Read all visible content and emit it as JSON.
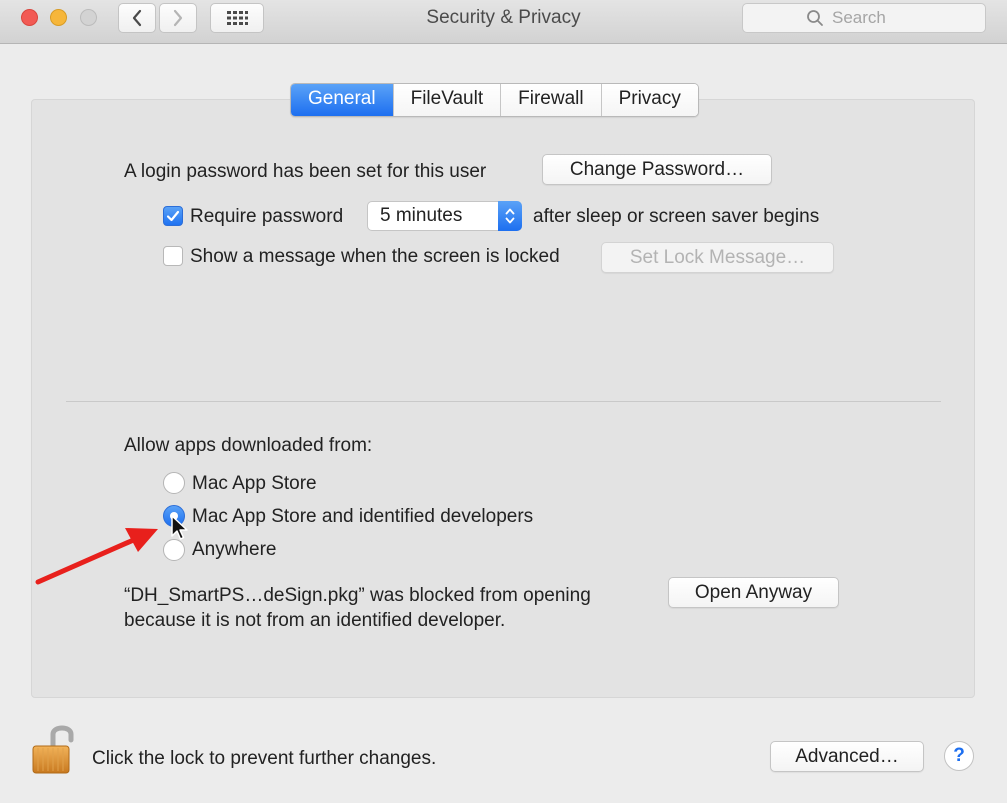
{
  "window": {
    "title": "Security & Privacy",
    "search_placeholder": "Search",
    "nav": {
      "back_icon": "chevron-left-icon",
      "forward_icon": "chevron-right-icon",
      "grid_icon": "grid-icon"
    }
  },
  "tabs": [
    {
      "label": "General",
      "active": true
    },
    {
      "label": "FileVault",
      "active": false
    },
    {
      "label": "Firewall",
      "active": false
    },
    {
      "label": "Privacy",
      "active": false
    }
  ],
  "general": {
    "login_text": "A login password has been set for this user",
    "change_password_label": "Change Password…",
    "require_password": {
      "label": "Require password",
      "checked": true
    },
    "password_delay": {
      "selected": "5 minutes"
    },
    "after_sleep_text": "after sleep or screen saver begins",
    "show_message": {
      "label": "Show a message when the screen is locked",
      "checked": false
    },
    "set_lock_message_label": "Set Lock Message…"
  },
  "gatekeeper": {
    "heading": "Allow apps downloaded from:",
    "options": [
      {
        "label": "Mac App Store",
        "checked": false
      },
      {
        "label": "Mac App Store and identified developers",
        "checked": true
      },
      {
        "label": "Anywhere",
        "checked": false
      }
    ],
    "blocked_line1": "“DH_SmartPS…deSign.pkg” was blocked from opening",
    "blocked_line2": "because it is not from an identified developer.",
    "open_anyway_label": "Open Anyway"
  },
  "footer": {
    "lock_text": "Click the lock to prevent further changes.",
    "advanced_label": "Advanced…",
    "help_label": "?"
  },
  "colors": {
    "accent": "#1d6ff0",
    "annotation_arrow": "#e8201c"
  }
}
